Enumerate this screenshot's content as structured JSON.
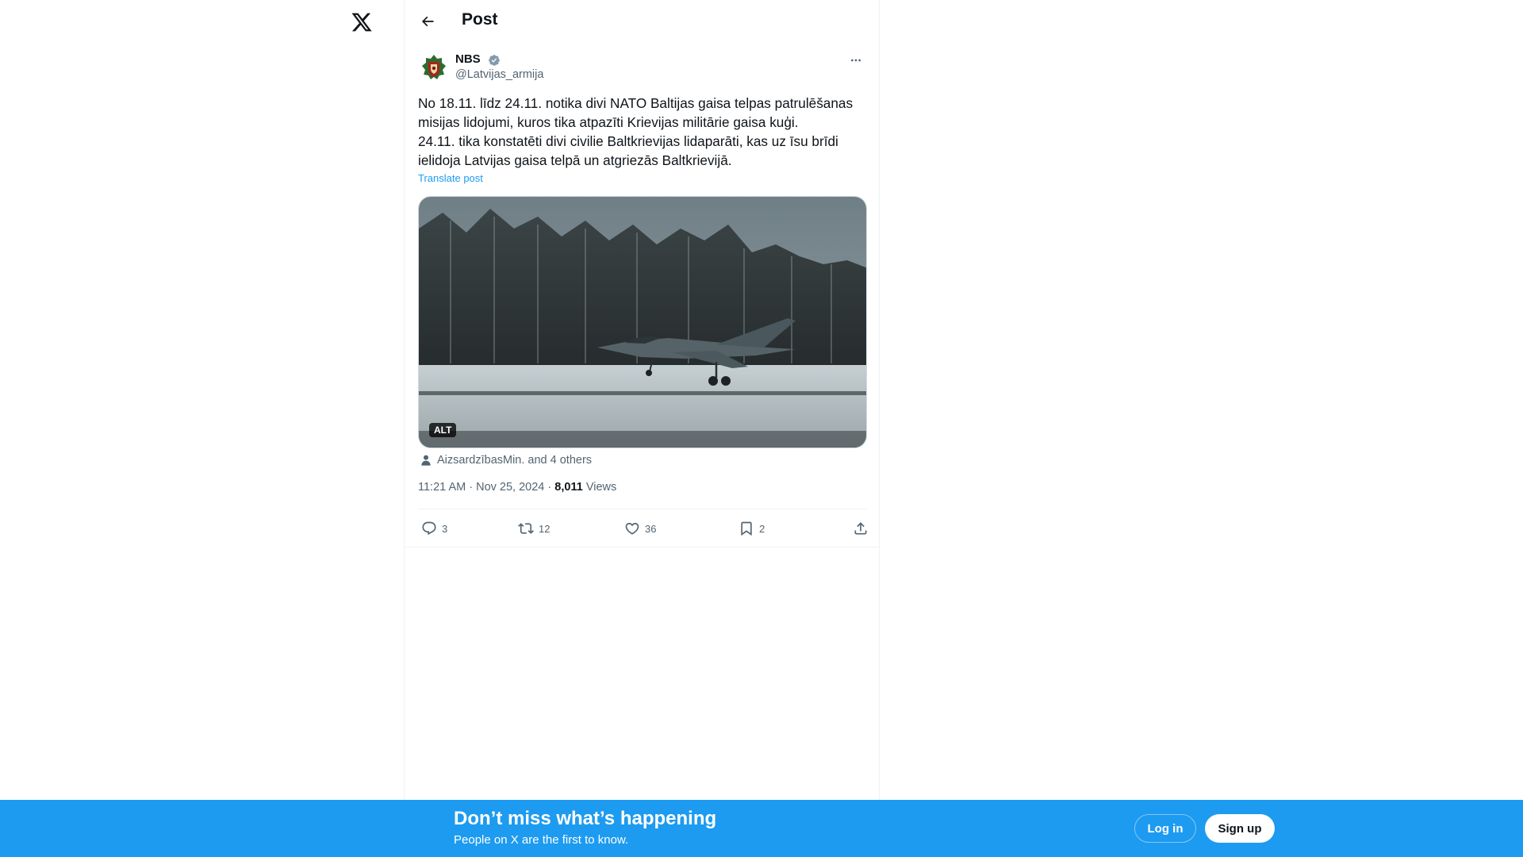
{
  "nav": {
    "logo_icon": "x-logo-icon"
  },
  "header": {
    "title": "Post",
    "back_icon": "arrow-left-icon"
  },
  "post": {
    "author": {
      "name": "NBS",
      "handle": "@Latvijas_armija",
      "verified": true,
      "verified_color": "#829aab"
    },
    "text_lines": [
      "No 18.11. līdz 24.11. notika divi NATO Baltijas gaisa telpas patrulēšanas misijas lidojumi, kuros tika atpazīti Krievijas militārie gaisa kuģi.",
      "24.11. tika konstatēti divi civilie Baltkrievijas lidaparāti, kas uz īsu brīdi ielidoja Latvijas gaisa telpā un atgriezās Baltkrievijā."
    ],
    "translate_label": "Translate post",
    "media": {
      "alt_badge": "ALT"
    },
    "tagged": "AizsardzībasMin. and 4 others",
    "time": "11:21 AM",
    "separator": "·",
    "date": "Nov 25, 2024",
    "views_count": "8,011",
    "views_label": "Views",
    "actions": {
      "replies": "3",
      "reposts": "12",
      "likes": "36",
      "bookmarks": "2"
    }
  },
  "banner": {
    "title": "Don’t miss what’s happening",
    "subtitle": "People on X are the first to know.",
    "login_label": "Log in",
    "signup_label": "Sign up",
    "color": "#1d9bf0"
  },
  "colors": {
    "accent": "#1d9bf0",
    "muted": "#536471",
    "text": "#0f1419"
  }
}
